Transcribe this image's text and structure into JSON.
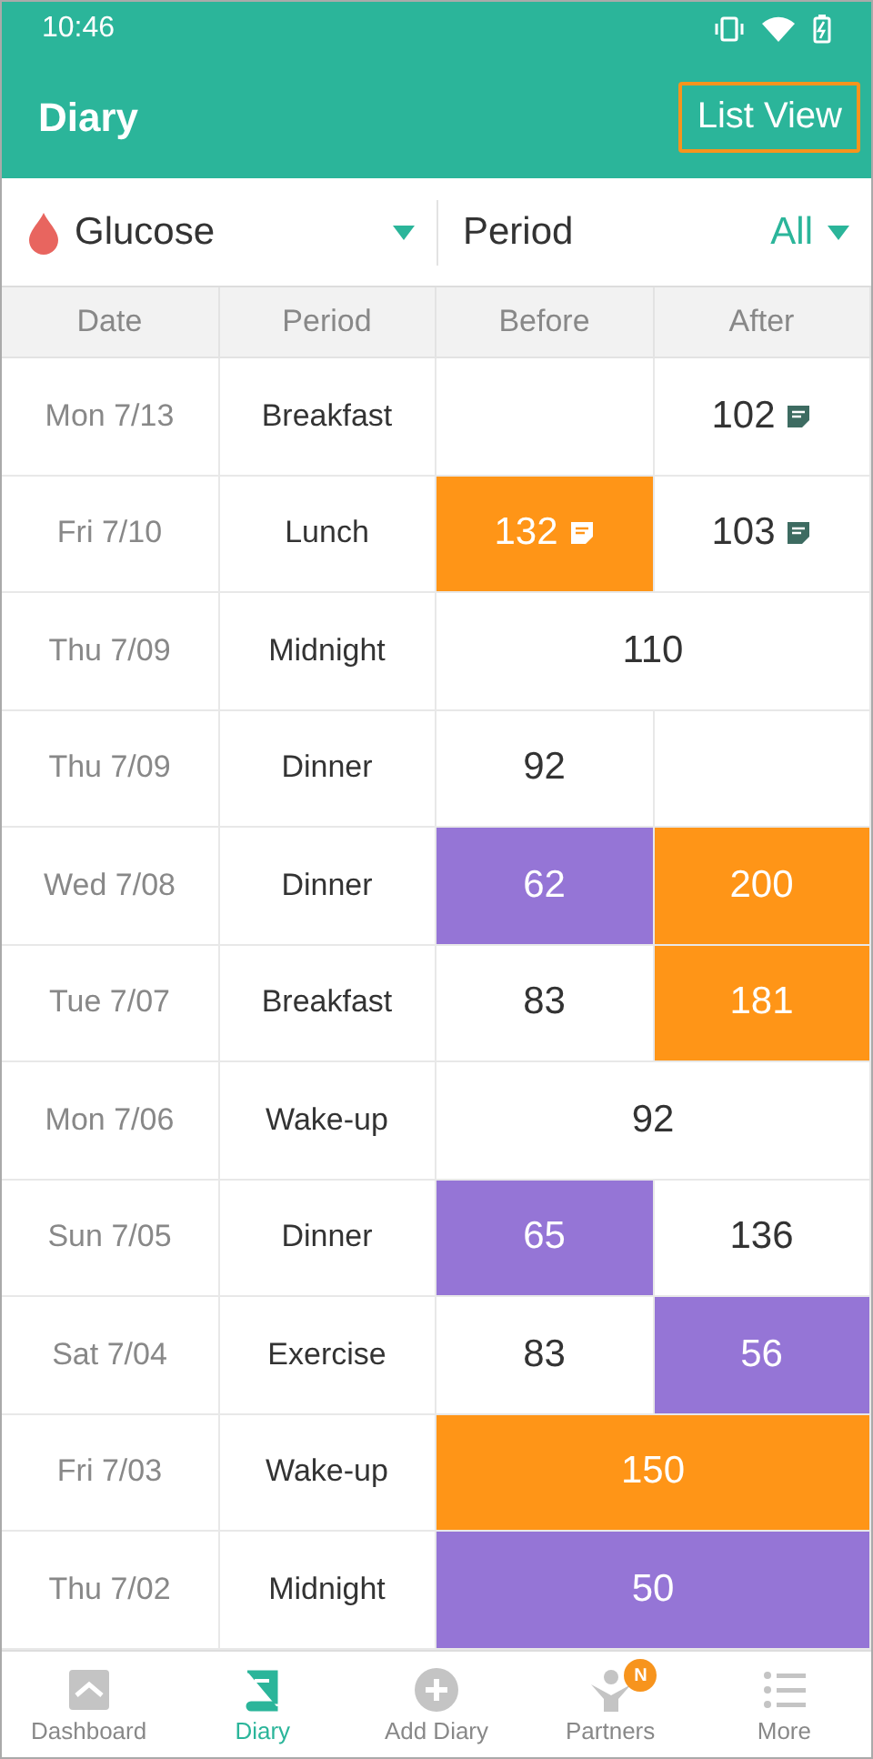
{
  "status_bar": {
    "time": "10:46"
  },
  "app_bar": {
    "title": "Diary",
    "action": {
      "label": "List View",
      "outlined": true
    }
  },
  "filters": {
    "measure": "Glucose",
    "period_label": "Period",
    "period_value": "All"
  },
  "table": {
    "columns": [
      "Date",
      "Period",
      "Before",
      "After"
    ],
    "rows": [
      {
        "date": "Mon 7/13",
        "period": "Breakfast",
        "kind": "split",
        "before": null,
        "after": {
          "value": "102",
          "note": true
        }
      },
      {
        "date": "Fri 7/10",
        "period": "Lunch",
        "kind": "split",
        "before": {
          "value": "132",
          "color": "#ff9517",
          "note": true
        },
        "after": {
          "value": "103",
          "note": true
        }
      },
      {
        "date": "Thu 7/09",
        "period": "Midnight",
        "kind": "merged",
        "value": {
          "value": "110"
        }
      },
      {
        "date": "Thu 7/09",
        "period": "Dinner",
        "kind": "split",
        "before": {
          "value": "92"
        },
        "after": null
      },
      {
        "date": "Wed 7/08",
        "period": "Dinner",
        "kind": "split",
        "before": {
          "value": "62",
          "color": "#9575d6"
        },
        "after": {
          "value": "200",
          "color": "#ff9517"
        }
      },
      {
        "date": "Tue 7/07",
        "period": "Breakfast",
        "kind": "split",
        "before": {
          "value": "83"
        },
        "after": {
          "value": "181",
          "color": "#ff9517"
        }
      },
      {
        "date": "Mon 7/06",
        "period": "Wake-up",
        "kind": "merged",
        "value": {
          "value": "92"
        }
      },
      {
        "date": "Sun 7/05",
        "period": "Dinner",
        "kind": "split",
        "before": {
          "value": "65",
          "color": "#9575d6"
        },
        "after": {
          "value": "136"
        }
      },
      {
        "date": "Sat 7/04",
        "period": "Exercise",
        "kind": "split",
        "before": {
          "value": "83"
        },
        "after": {
          "value": "56",
          "color": "#9575d6"
        }
      },
      {
        "date": "Fri 7/03",
        "period": "Wake-up",
        "kind": "merged",
        "value": {
          "value": "150",
          "color": "#ff9517"
        }
      },
      {
        "date": "Thu 7/02",
        "period": "Midnight",
        "kind": "merged",
        "value": {
          "value": "50",
          "color": "#9575d6"
        }
      }
    ]
  },
  "bottom_nav": [
    {
      "label": "Dashboard",
      "selected": false
    },
    {
      "label": "Diary",
      "selected": true
    },
    {
      "label": "Add Diary",
      "selected": false
    },
    {
      "label": "Partners",
      "selected": false,
      "badge": "N"
    },
    {
      "label": "More",
      "selected": false
    }
  ]
}
